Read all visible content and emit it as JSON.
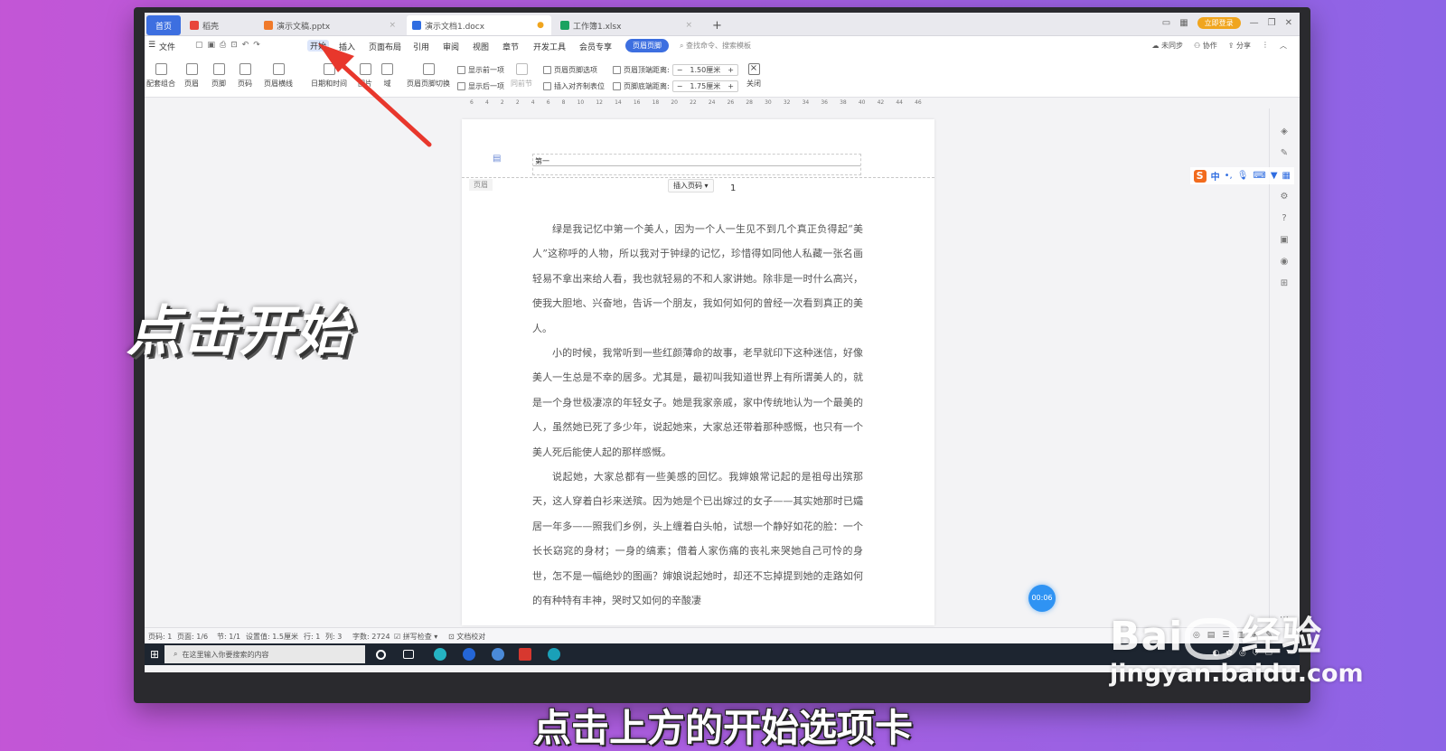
{
  "tabs": {
    "home": "首页",
    "items": [
      {
        "label": "稻壳",
        "color": "#e8453c"
      },
      {
        "label": "演示文稿.pptx",
        "color": "#f07a2a"
      },
      {
        "label": "演示文档1.docx",
        "color": "#2f6de1"
      },
      {
        "label": "工作簿1.xlsx",
        "color": "#1aa260"
      }
    ],
    "add": "+",
    "login": "立即登录"
  },
  "menu": {
    "file": "文件",
    "items": [
      "开始",
      "插入",
      "页面布局",
      "引用",
      "审阅",
      "视图",
      "章节",
      "开发工具",
      "会员专享"
    ],
    "active_pill": "页眉页脚",
    "search": "查找命令、搜索模板",
    "right": [
      "未同步",
      "协作",
      "分享"
    ]
  },
  "ribbon": {
    "buttons": [
      "配套组合",
      "页眉",
      "页脚",
      "页码",
      "页眉横线",
      "日期和时间",
      "图片",
      "域",
      "页眉页脚切换"
    ],
    "show_prev": "显示前一项",
    "show_next": "显示后一项",
    "same_as_prev": "同前节",
    "header_options": "页眉页脚选项",
    "insert_align_tab": "插入对齐制表位",
    "header_top_dist": "页眉顶端距离:",
    "header_top_val": "1.50厘米",
    "footer_bottom_dist": "页脚底端距离:",
    "footer_bottom_val": "1.75厘米",
    "close": "关闭"
  },
  "ruler": [
    "6",
    "4",
    "2",
    "2",
    "4",
    "6",
    "8",
    "10",
    "12",
    "14",
    "16",
    "18",
    "20",
    "22",
    "24",
    "26",
    "28",
    "30",
    "32",
    "34",
    "36",
    "38",
    "40",
    "42",
    "44",
    "46"
  ],
  "document": {
    "header_text": "第一",
    "header_label": "页眉",
    "insert_page_num": "插入页码",
    "page_number": "1",
    "paragraphs": [
      "绿是我记忆中第一个美人，因为一个人一生见不到几个真正负得起“美人”这称呼的人物，所以我对于钟绿的记忆，珍惜得如同他人私藏一张名画轻易不拿出来给人看，我也就轻易的不和人家讲她。除非是一时什么高兴，使我大胆地、兴奋地，告诉一个朋友，我如何如何的曾经一次看到真正的美人。",
      "小的时候，我常听到一些红颜薄命的故事，老早就印下这种迷信，好像美人一生总是不幸的居多。尤其是，最初叫我知道世界上有所谓美人的，就是一个身世极凄凉的年轻女子。她是我家亲戚，家中传统地认为一个最美的人，虽然她已死了多少年，说起她来，大家总还带着那种感慨，也只有一个美人死后能使人起的那样感慨。",
      "说起她，大家总都有一些美感的回忆。我婶娘常记起的是祖母出殡那天，这人穿着白衫来送殡。因为她是个已出嫁过的女子——其实她那时已孀居一年多——照我们乡例，头上缠着白头帕，试想一个静好如花的脸：一个长长窈窕的身材；一身的缟素；借着人家伤痛的丧礼来哭她自己可怜的身世，怎不是一幅绝妙的图画？婶娘说起她时，却还不忘掉提到她的走路如何的有种特有丰神，哭时又如何的辛酸凄"
    ]
  },
  "timer": "00:06",
  "status": {
    "page_code": "页码: 1",
    "page": "页面: 1/6",
    "section": "节: 1/1",
    "setting": "设置值: 1.5厘米",
    "row": "行: 1",
    "col": "列: 3",
    "words": "字数: 2724",
    "spell": "拼写检查",
    "proof": "文档校对"
  },
  "taskbar": {
    "search_placeholder": "在这里输入你要搜索的内容"
  },
  "ime": {
    "logo": "S",
    "mode": "中"
  },
  "overlay": {
    "title": "点击开始",
    "subtitle": "点击上方的开始选项卡"
  },
  "watermark": {
    "brand_left": "Bai",
    "brand_right": "经验",
    "url": "jingyan.baidu.com"
  },
  "colors": {
    "accent_blue": "#3d6fe0",
    "arrow_red": "#e8372c",
    "timer_blue": "#2f93f3"
  }
}
